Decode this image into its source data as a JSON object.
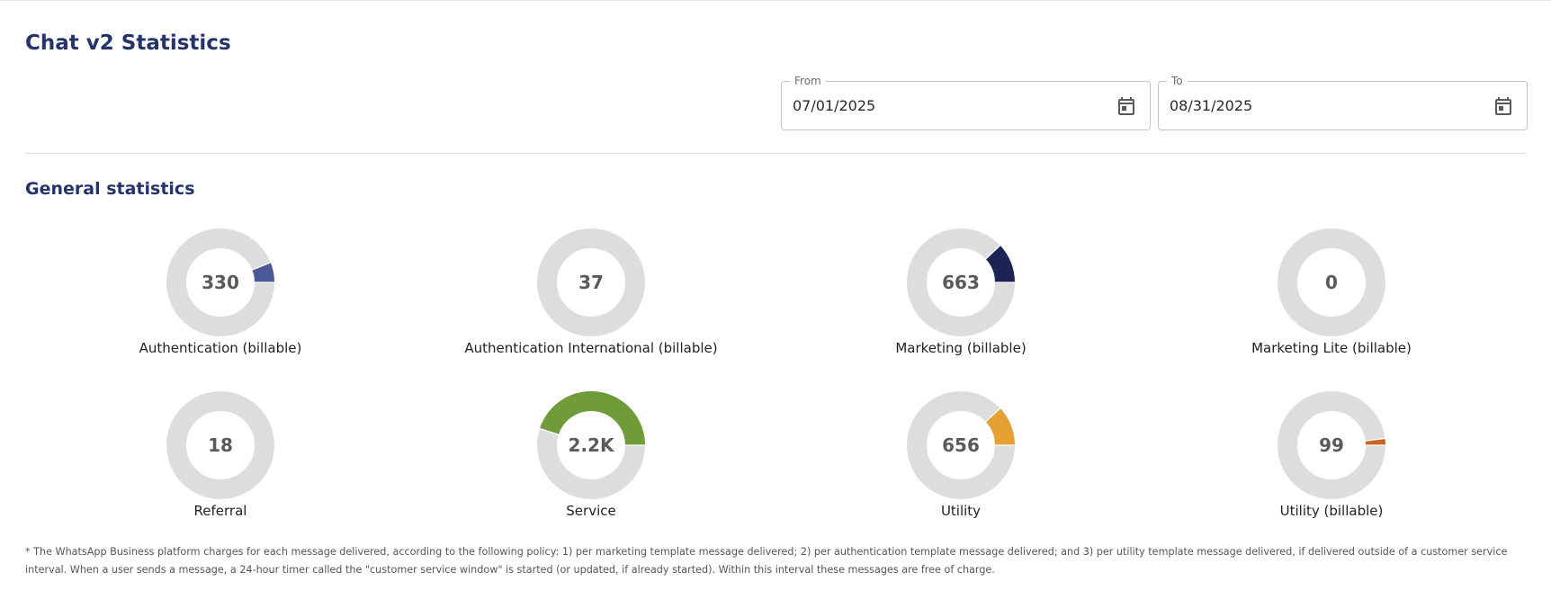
{
  "page": {
    "title": "Chat v2 Statistics"
  },
  "filters": {
    "from": {
      "label": "From",
      "value": "07/01/2025",
      "icon": "calendar-icon"
    },
    "to": {
      "label": "To",
      "value": "08/31/2025",
      "icon": "calendar-icon"
    }
  },
  "section": {
    "title": "General statistics"
  },
  "stats": [
    {
      "key": "authentication-billable",
      "label": "Authentication (billable)",
      "value": "330",
      "fraction": 0.06,
      "color": "#4b5a96"
    },
    {
      "key": "authentication-international-billable",
      "label": "Authentication International (billable)",
      "value": "37",
      "fraction": 0.0,
      "color": "#4b5a96"
    },
    {
      "key": "marketing-billable",
      "label": "Marketing (billable)",
      "value": "663",
      "fraction": 0.12,
      "color": "#1c2357"
    },
    {
      "key": "marketing-lite-billable",
      "label": "Marketing Lite (billable)",
      "value": "0",
      "fraction": 0.0,
      "color": "#1c2357"
    },
    {
      "key": "referral",
      "label": "Referral",
      "value": "18",
      "fraction": 0.0,
      "color": "#7b8b9b"
    },
    {
      "key": "service",
      "label": "Service",
      "value": "2.2K",
      "fraction": 0.45,
      "color": "#709b39"
    },
    {
      "key": "utility",
      "label": "Utility",
      "value": "656",
      "fraction": 0.12,
      "color": "#e5a133"
    },
    {
      "key": "utility-billable",
      "label": "Utility (billable)",
      "value": "99",
      "fraction": 0.02,
      "color": "#c9651e"
    }
  ],
  "colors": {
    "track": "#dddddd",
    "heading": "#25336b"
  },
  "footnote": "* The WhatsApp Business platform charges for each message delivered, according to the following policy: 1) per marketing template message delivered; 2) per authentication template message delivered; and 3) per utility template message delivered, if delivered outside of a customer service interval. When a user sends a message, a 24-hour timer called the \"customer service window\" is started (or updated, if already started). Within this interval these messages are free of charge."
}
